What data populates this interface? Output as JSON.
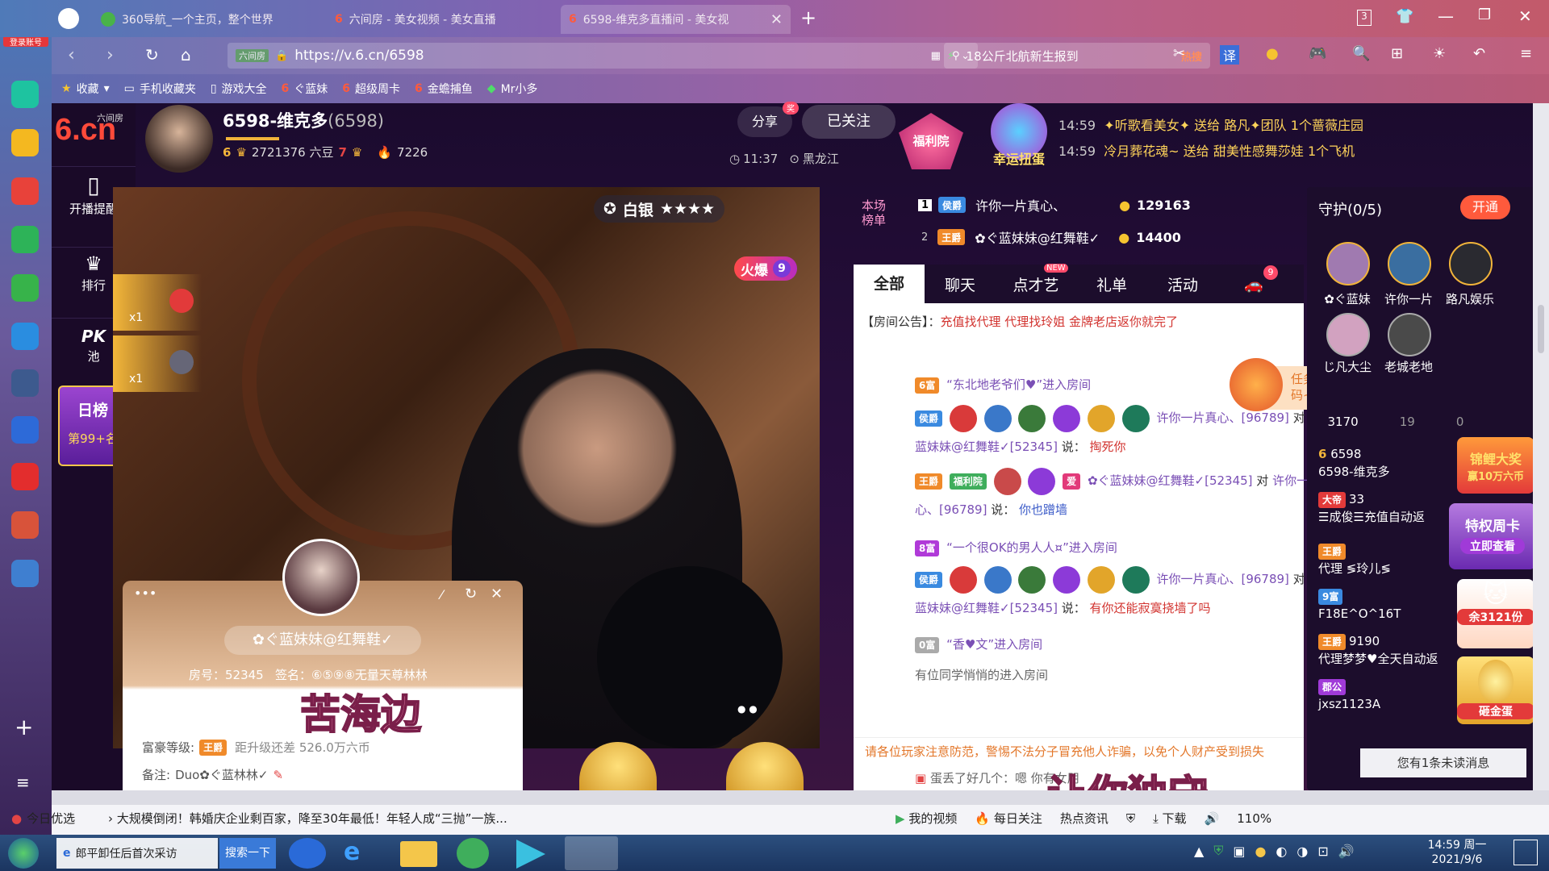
{
  "browser": {
    "login_label": "登录账号",
    "tabs": [
      {
        "title": "360导航_一个主页，整个世界"
      },
      {
        "title": "六间房 - 美女视频 - 美女直播"
      },
      {
        "title": "6598-维克多直播间 - 美女视"
      }
    ],
    "tab_count": "3",
    "url_prefix": "六间房",
    "url": "https://v.6.cn/6598",
    "search_text": "18公斤北航新生报到",
    "search_hot": "热搜",
    "bookmarks": [
      "收藏",
      "手机收藏夹",
      "游戏大全",
      "ぐ蓝妹",
      "超级周卡",
      "金蟾捕鱼",
      "Mr小多"
    ],
    "translate_label": "译"
  },
  "header": {
    "logo_text": "6.cn",
    "logo_sub": "六间房",
    "streamer_name": "6598-维克多",
    "room_id": "(6598)",
    "level_left": "6",
    "beans": "2721376 六豆",
    "level_right": "7",
    "fans": "7226",
    "time": "11:37",
    "location": "黑龙江",
    "share_label": "分享",
    "share_badge": "奖",
    "follow_label": "已关注",
    "welfare_label": "福利院",
    "lucky_label": "幸运扭蛋"
  },
  "left_nav": [
    {
      "label": "开播提醒",
      "icon": "phone-icon"
    },
    {
      "label": "排行",
      "icon": "crown-icon"
    },
    {
      "label": "池",
      "icon": "pk-icon",
      "title": "PK"
    }
  ],
  "day_rank": {
    "title": "日榜",
    "rank": "第99+名"
  },
  "video": {
    "tier": "白银",
    "stars": "★★★★",
    "hot_label": "火爆",
    "hot_level": "9",
    "gifts": [
      {
        "count": "x1"
      },
      {
        "count": "x1"
      }
    ],
    "overlay_text_1": "苦海边",
    "overlay_text_2": "让你独守"
  },
  "profile_card": {
    "name": "✿ぐ蓝妹妹@红舞鞋✓",
    "room_label": "房号：52345",
    "sign_label": "签名：⑥⑤⑨⑧无量天尊林林",
    "rich_label": "富豪等级:",
    "rich_badge": "王爵",
    "upgrade_text": "距升级还差 526.0万六币",
    "note_label": "备注:",
    "note_value": "Duo✿ぐ蓝林林✓"
  },
  "broadcast": [
    {
      "time": "14:59",
      "text": "✦听歌看美女✦ 送给 路凡✦团队 1个蔷薇庄园"
    },
    {
      "time": "14:59",
      "text": "冷月葬花魂~ 送给 甜美性感舞莎娃 1个飞机"
    }
  ],
  "session_rank": {
    "title": "本场榜单",
    "rows": [
      {
        "rank": "1",
        "badge": "侯爵",
        "name": "许你一片真心、",
        "value": "129163"
      },
      {
        "rank": "2",
        "badge": "王爵",
        "name": "✿ぐ蓝妹妹@红舞鞋✓",
        "value": "14400"
      }
    ]
  },
  "chat_tabs": [
    {
      "label": "全部",
      "active": true
    },
    {
      "label": "聊天",
      "dot": true
    },
    {
      "label": "点才艺",
      "badge": "NEW"
    },
    {
      "label": "礼单"
    },
    {
      "label": "活动"
    },
    {
      "label": "",
      "icon": "car-icon",
      "badge": "9"
    }
  ],
  "chat": {
    "notice_label": "【房间公告】：",
    "notice_text": "充值找代理 代理找玲姐 金牌老店返你就完了",
    "lines": [
      {
        "badge": "6富",
        "text": "“东北地老爷们♥”进入房间"
      },
      {
        "badge": "侯爵",
        "from": "许你一片真心、[96789]",
        "to": "✿ぐ蓝妹妹@红舞鞋✓[52345]",
        "msg": "掏死你"
      },
      {
        "badge": "王爵",
        "from": "✿ぐ蓝妹妹@红舞鞋✓[52345]",
        "to": "许你一片真心、[96789]",
        "msg": "你也蹭墙"
      },
      {
        "badge": "8富",
        "text": "“一个很OK的男人人¤”进入房间"
      },
      {
        "badge": "侯爵",
        "from": "许你一片真心、[96789]",
        "to": "✿ぐ蓝妹妹@红舞鞋✓[52345]",
        "msg": "有你还能寂寞挠墙了吗"
      },
      {
        "badge": "0富",
        "text": "“香♥文”进入房间"
      },
      {
        "text": "有位同学悄悄的进入房间"
      }
    ],
    "medal_tags": [
      "福利院",
      "爱",
      "富"
    ],
    "warning": "请各位玩家注意防范，警惕不法分子冒充他人诈骗，以免个人财产受到损失",
    "bottom_partial": "蛋丢了好几个：嗯 你有女朋"
  },
  "task_popup": "任务完成，点击领取锦鲤活动幸运码~",
  "guard": {
    "title": "守护(0/5)",
    "open_label": "开通",
    "members": [
      "✿ぐ蓝妹",
      "许你一片",
      "路凡娱乐",
      "じ凡大尘",
      "老城老地"
    ],
    "stats": [
      "3170",
      "19",
      "0"
    ]
  },
  "audience": [
    {
      "level": "6",
      "name": "6598",
      "sub": "6598-维克多"
    },
    {
      "badge": "大帝",
      "name": "☰成俊☰充值自动返",
      "extra": "33"
    },
    {
      "badge": "王爵",
      "name": "代理 ≶玲儿≶"
    },
    {
      "badge": "9富",
      "name": "F18E^O^16T"
    },
    {
      "badge": "王爵",
      "name": "代理梦梦♥全天自动返",
      "extra": "9190"
    },
    {
      "badge": "郡公",
      "name": "jxsz1123A"
    }
  ],
  "promos": [
    {
      "title": "锦鲤大奖",
      "sub": "赢10万六币"
    },
    {
      "title": "特权周卡",
      "sub": "立即查看"
    },
    {
      "title": "余3121份"
    },
    {
      "title": "砸金蛋"
    }
  ],
  "unread": "您有1条未读消息",
  "statusbar": {
    "today_pick": "今日优选",
    "news": "大规模倒闭！韩婚庆企业剩百家，降至30年最低！年轻人成“三抛”一族...",
    "my_video": "我的视频",
    "daily_focus": "每日关注",
    "hot_news": "热点资讯",
    "download": "下载",
    "zoom": "110%"
  },
  "taskbar": {
    "task_text": "郎平卸任后首次采访",
    "search_btn": "搜索一下",
    "time": "14:59 周一",
    "date": "2021/9/6"
  },
  "colors": {
    "accent_red": "#e34545",
    "orange": "#ff8a3d",
    "purple": "#7a4fb5"
  }
}
